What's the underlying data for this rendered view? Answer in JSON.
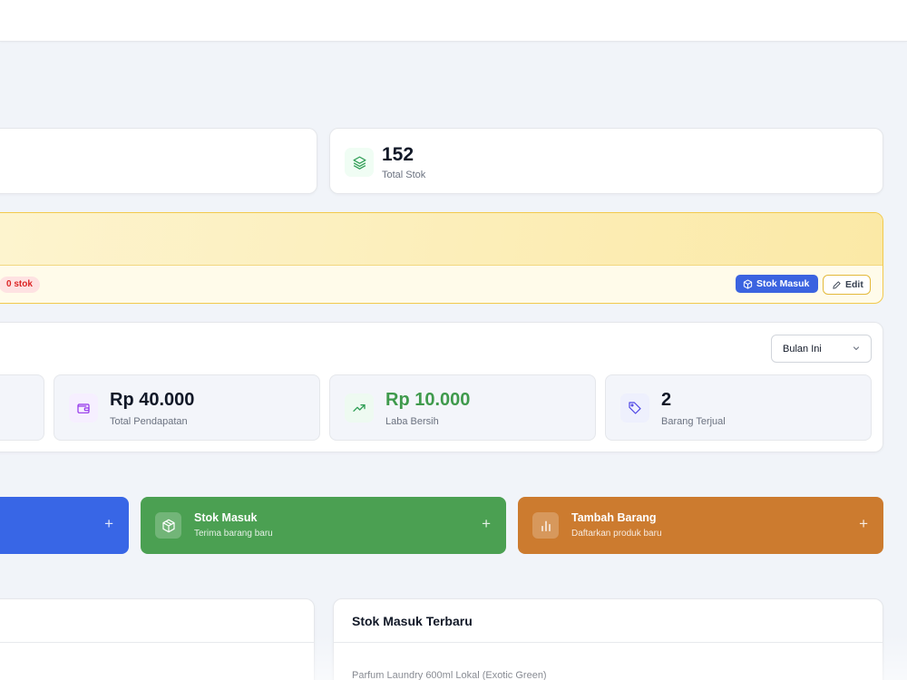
{
  "summary": {
    "total_stok": {
      "value": "152",
      "label": "Total Stok",
      "icon": "layers-icon"
    }
  },
  "alert": {
    "badge": "0 stok",
    "stok_masuk_label": "Stok Masuk",
    "edit_label": "Edit"
  },
  "report": {
    "period_select": "Bulan Ini",
    "cards": [
      {
        "value": "Rp 40.000",
        "label": "Total Pendapatan",
        "icon": "wallet-icon",
        "value_color": "#111827"
      },
      {
        "value": "Rp 10.000",
        "label": "Laba Bersih",
        "icon": "trending-up-icon",
        "value_color": "#3f9a4c"
      },
      {
        "value": "2",
        "label": "Barang Terjual",
        "icon": "tag-icon",
        "value_color": "#111827"
      }
    ]
  },
  "actions": [
    {
      "title": "Stok Masuk",
      "subtitle": "Terima barang baru",
      "icon": "box-icon",
      "color": "#4ba052"
    },
    {
      "title": "Tambah Barang",
      "subtitle": "Daftarkan produk baru",
      "icon": "bar-chart-icon",
      "color": "#cc7b2f"
    }
  ],
  "blue_action_color": "#3866e6",
  "panels": {
    "recent_stock_in": {
      "title": "Stok Masuk Terbaru",
      "first_item": "Parfum Laundry 600ml Lokal (Exotic Green)"
    }
  },
  "colors": {
    "background": "#f1f4f9",
    "primary": "#3b63e0",
    "alert_border": "#f2c94c"
  }
}
